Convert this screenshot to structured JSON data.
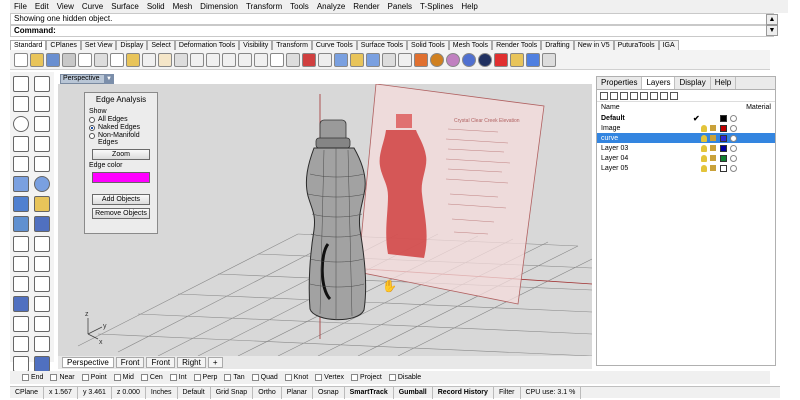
{
  "menu": [
    "File",
    "Edit",
    "View",
    "Curve",
    "Surface",
    "Solid",
    "Mesh",
    "Dimension",
    "Transform",
    "Tools",
    "Analyze",
    "Render",
    "Panels",
    "T-Splines",
    "Help"
  ],
  "command_history": "Showing one hidden object.",
  "command_prompt": "Command:",
  "toolbar_tabs": [
    "Standard",
    "CPlanes",
    "Set View",
    "Display",
    "Select",
    "Deformation Tools",
    "Visibility",
    "Transform",
    "Curve Tools",
    "Surface Tools",
    "Solid Tools",
    "Mesh Tools",
    "Render Tools",
    "Drafting",
    "New in V5",
    "PuturaTools",
    "IGA"
  ],
  "viewport": {
    "title": "Perspective",
    "tabs": [
      "Perspective",
      "Front",
      "Front",
      "Right"
    ],
    "add_tab": "+"
  },
  "edge_analysis": {
    "title": "Edge Analysis",
    "show_label": "Show",
    "options": [
      "All Edges",
      "Naked Edges",
      "Non-Manifold Edges"
    ],
    "selected": "Naked Edges",
    "zoom_button": "Zoom",
    "edge_color_label": "Edge color",
    "edge_color": "#ff00ff",
    "add_objects_button": "Add Objects",
    "remove_objects_button": "Remove Objects"
  },
  "reference_text": "Crystal Clear Creek Elevation",
  "panel": {
    "tabs": [
      "Properties",
      "Layers",
      "Display",
      "Help"
    ],
    "active_tab": "Layers",
    "column_name": "Name",
    "column_material": "Material",
    "layers": [
      {
        "name": "Default",
        "color": "#000000",
        "current": "✔"
      },
      {
        "name": "Image",
        "color": "#c00000"
      },
      {
        "name": "curve",
        "color": "#2b2bd6"
      },
      {
        "name": "Layer 03",
        "color": "#0000a0"
      },
      {
        "name": "Layer 04",
        "color": "#108030"
      },
      {
        "name": "Layer 05",
        "color": "#ffffff"
      }
    ],
    "selected_layer": "curve"
  },
  "osnap": [
    "End",
    "Near",
    "Point",
    "Mid",
    "Cen",
    "Int",
    "Perp",
    "Tan",
    "Quad",
    "Knot",
    "Vertex",
    "Project",
    "Disable"
  ],
  "status": {
    "cplane": "CPlane",
    "x": "x 1.567",
    "y": "y 3.461",
    "z": "z 0.000",
    "units": "Inches",
    "layer": "Default",
    "grid_snap": "Grid Snap",
    "ortho": "Ortho",
    "planar": "Planar",
    "osnap": "Osnap",
    "smarttrack": "SmartTrack",
    "gumball": "Gumball",
    "record_history": "Record History",
    "filter": "Filter",
    "cpu": "CPU use: 3.1 %"
  },
  "axis_labels": {
    "x": "x",
    "y": "y",
    "z": "z"
  },
  "colors": {
    "accent": "#3385e0",
    "bottle_red": "#d04040",
    "grid": "#8a8a8a",
    "background": "#d8d8d8"
  }
}
